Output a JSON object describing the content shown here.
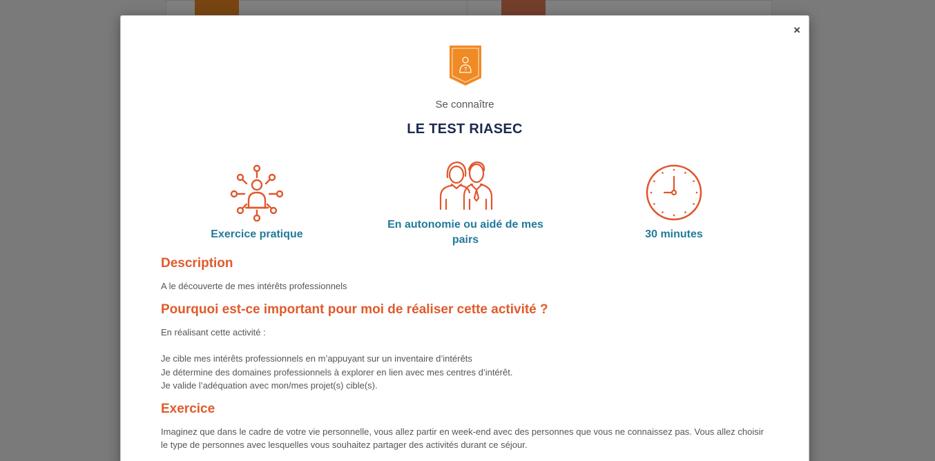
{
  "modal": {
    "close_label": "×",
    "subtitle": "Se connaître",
    "title": "LE TEST RIASEC",
    "badge_icon": "person-question-icon",
    "features": [
      {
        "label": "Exercice pratique",
        "icon": "network-person-icon"
      },
      {
        "label": "En autonomie ou aidé de mes pairs",
        "icon": "two-people-icon"
      },
      {
        "label": "30 minutes",
        "icon": "clock-icon"
      }
    ],
    "sections": {
      "description": {
        "heading": "Description",
        "text": "A le découverte de mes intérêts professionnels"
      },
      "why": {
        "heading": "Pourquoi est-ce important pour moi de réaliser cette activité ?",
        "intro": "En réalisant cette activité :",
        "lines": [
          "Je cible mes intérêts professionnels en m’appuyant sur un inventaire d’intérêts",
          "Je détermine des domaines professionnels à explorer en lien avec mes centres d’intérêt.",
          "Je valide l’adéquation avec mon/mes projet(s) cible(s)."
        ]
      },
      "exercise": {
        "heading": "Exercice",
        "text": "Imaginez que dans le cadre de votre vie personnelle, vous allez partir en week-end avec des personnes que vous ne connaissez pas. Vous allez choisir le type de personnes avec lesquelles vous souhaitez partager des activités durant ce séjour."
      }
    }
  },
  "colors": {
    "overlay": "rgba(0,0,0,0.5)",
    "badge": "#f08a24",
    "title": "#1b2a4e",
    "feature_label": "#217a9a",
    "heading": "#e05a2b",
    "icon": "#e0562c",
    "body_text": "#555555"
  }
}
